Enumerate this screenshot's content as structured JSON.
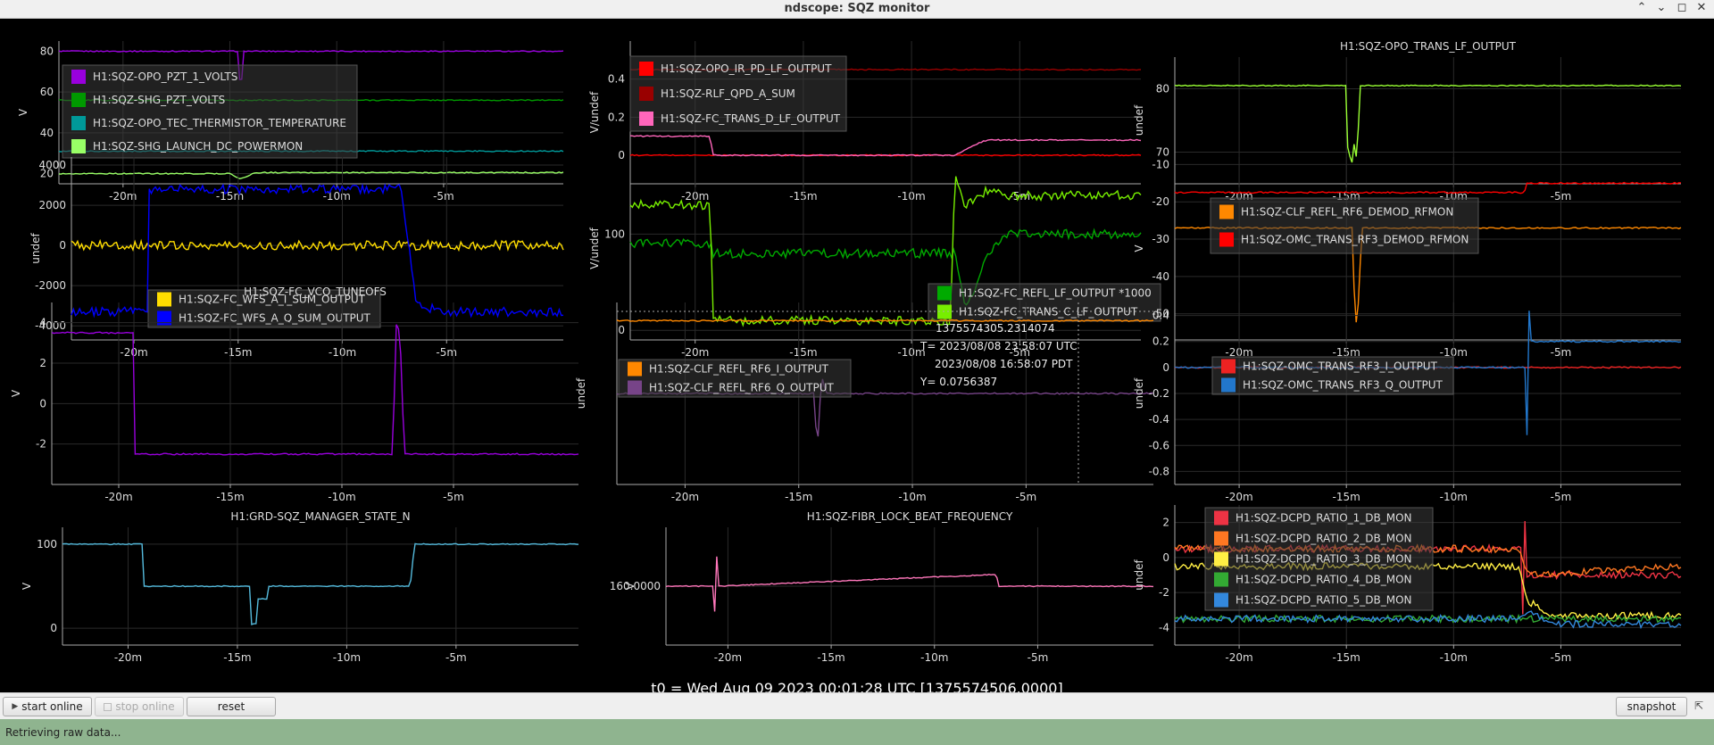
{
  "window": {
    "title": "ndscope: SQZ monitor"
  },
  "t0_label": "t0 = Wed Aug 09 2023 00:01:28 UTC [1375574506.0000]",
  "toolbar": {
    "start_online": "start online",
    "stop_online": "stop online",
    "reset": "reset",
    "snapshot": "snapshot"
  },
  "status": "Retrieving raw data...",
  "colors": {
    "background": "#000000",
    "status_bar": "#8fb48f"
  },
  "chart_data": [
    {
      "type": "line",
      "ylabel": "V",
      "ylim": [
        15,
        85
      ],
      "yticks": [
        20,
        40,
        60,
        80
      ],
      "xlim": [
        -23,
        0.6
      ],
      "xticks": [
        -20,
        -15,
        -10,
        -5
      ],
      "xticklabels": [
        "-20m",
        "-15m",
        "-10m",
        "-5m"
      ],
      "grid": true,
      "legend": "top-left",
      "series": [
        {
          "name": "H1:SQZ-OPO_PZT_1_VOLTS",
          "color": "#9900dd",
          "x": [
            -23,
            -14.6,
            -14.6,
            -14.35,
            -14.35,
            0.6
          ],
          "y": [
            80,
            80,
            66,
            66,
            80,
            80
          ]
        },
        {
          "name": "H1:SQZ-SHG_PZT_VOLTS",
          "color": "#009900",
          "x": [
            -23,
            0.6
          ],
          "y": [
            56,
            56
          ]
        },
        {
          "name": "H1:SQZ-OPO_TEC_THERMISTOR_TEMPERATURE",
          "color": "#009999",
          "x": [
            -23,
            0.6
          ],
          "y": [
            31,
            31
          ]
        },
        {
          "name": "H1:SQZ-SHG_LAUNCH_DC_POWERMON",
          "color": "#99ff66",
          "x": [
            -23,
            -15,
            -14.5,
            -14.2,
            -13.8,
            0.6
          ],
          "y": [
            20,
            20,
            17.5,
            18.5,
            20.5,
            20.5
          ]
        }
      ]
    },
    {
      "type": "line",
      "ylabel": "V/undef",
      "ylim": [
        -0.15,
        0.6
      ],
      "yticks": [
        0,
        0.2,
        0.4
      ],
      "xlim": [
        -23,
        0.6
      ],
      "xticks": [
        -20,
        -15,
        -10,
        -5
      ],
      "xticklabels": [
        "-20m",
        "-15m",
        "-10m",
        "-5m"
      ],
      "grid": true,
      "legend": "top-left",
      "series": [
        {
          "name": "H1:SQZ-OPO_IR_PD_LF_OUTPUT",
          "color": "#ff0000",
          "x": [
            -23,
            0.6
          ],
          "y": [
            0,
            0
          ]
        },
        {
          "name": "H1:SQZ-RLF_QPD_A_SUM",
          "color": "#990000",
          "x": [
            -23,
            0.6
          ],
          "y": [
            0.45,
            0.45
          ]
        },
        {
          "name": "H1:SQZ-FC_TRANS_D_LF_OUTPUT",
          "color": "#ff66bb",
          "x": [
            -23,
            -19.3,
            -19.2,
            -8,
            -7.5,
            -7,
            -6.5,
            0.6
          ],
          "y": [
            0.1,
            0.1,
            0,
            0,
            0.03,
            0.06,
            0.08,
            0.08
          ]
        }
      ]
    },
    {
      "type": "line",
      "title": "H1:SQZ-OPO_TRANS_LF_OUTPUT",
      "ylabel": "undef",
      "ylim": [
        65,
        85
      ],
      "yticks": [
        70,
        80
      ],
      "xlim": [
        -23,
        0.6
      ],
      "xticks": [
        -20,
        -15,
        -10,
        -5
      ],
      "xticklabels": [
        "-20m",
        "-15m",
        "-10m",
        "-5m"
      ],
      "grid": true,
      "series": [
        {
          "name": "",
          "color": "#99ff33",
          "x": [
            -23,
            -15,
            -14.9,
            -14.8,
            -14.7,
            -14.6,
            -14.5,
            -14.4,
            0.6
          ],
          "y": [
            80.5,
            80.5,
            65,
            72,
            66,
            75,
            65,
            80.5,
            80.5
          ]
        }
      ]
    },
    {
      "type": "line",
      "ylabel": "undef",
      "ylim": [
        -4700,
        4400
      ],
      "yticks": [
        -4000,
        -2000,
        0,
        2000,
        4000
      ],
      "xlim": [
        -23,
        0.6
      ],
      "xticks": [
        -20,
        -15,
        -10,
        -5
      ],
      "xticklabels": [
        "-20m",
        "-15m",
        "-10m",
        "-5m"
      ],
      "grid": true,
      "legend": "bottom-left",
      "series": [
        {
          "name": "H1:SQZ-FC_WFS_A_I_SUM_OUTPUT",
          "color": "#ffdd00",
          "x": [
            -23,
            0.6
          ],
          "y": [
            0,
            0
          ]
        },
        {
          "name": "H1:SQZ-FC_WFS_A_Q_SUM_OUTPUT",
          "color": "#0000ff",
          "x": [
            -23,
            -19.3,
            -19.3,
            -7.2,
            -6.5,
            -6,
            -5,
            0.6
          ],
          "y": [
            -3300,
            -3300,
            2800,
            2800,
            -2500,
            -3100,
            -3300,
            -3300
          ]
        }
      ]
    },
    {
      "type": "line",
      "ylabel": "V/undef",
      "ylim": [
        -10,
        180
      ],
      "yticks": [
        0,
        100
      ],
      "xlim": [
        -23,
        0.6
      ],
      "xticks": [
        -20,
        -15,
        -10,
        -5
      ],
      "xticklabels": [
        "-20m",
        "-15m",
        "-10m",
        "-5m"
      ],
      "grid": true,
      "legend": "bottom-right",
      "series": [
        {
          "name": "H1:SQZ-FC_REFL_LF_OUTPUT *1000",
          "color": "#00aa00",
          "x": [
            -23,
            -19.3,
            -19.2,
            -8,
            -7.5,
            -6.5,
            -5.5,
            0.6
          ],
          "y": [
            90,
            90,
            80,
            80,
            20,
            80,
            100,
            100
          ]
        },
        {
          "name": "H1:SQZ-FC_TRANS_C_LF_OUTPUT",
          "color": "#77ee00",
          "x": [
            -23,
            -19.3,
            -19.2,
            -8.2,
            -8,
            -7.5,
            -6.5,
            -5.5,
            0.6
          ],
          "y": [
            130,
            130,
            10,
            10,
            160,
            130,
            145,
            140,
            140
          ]
        }
      ]
    },
    {
      "type": "line",
      "ylabel": "V",
      "ylim": [
        -57,
        -8
      ],
      "yticks": [
        -50,
        -40,
        -30,
        -20,
        -10
      ],
      "xlim": [
        -23,
        0.6
      ],
      "xticks": [
        -20,
        -15,
        -10,
        -5
      ],
      "xticklabels": [
        "-20m",
        "-15m",
        "-10m",
        "-5m"
      ],
      "grid": true,
      "legend": "top-left",
      "series": [
        {
          "name": "H1:SQZ-CLF_REFL_RF6_DEMOD_RFMON",
          "color": "#ff8800",
          "x": [
            -23,
            -14.7,
            -14.6,
            -14.4,
            -14.3,
            0.6
          ],
          "y": [
            -27,
            -27,
            -55,
            -45,
            -27,
            -27
          ]
        },
        {
          "name": "H1:SQZ-OMC_TRANS_RF3_DEMOD_RFMON",
          "color": "#ff0000",
          "x": [
            -23,
            -6.7,
            -6.6,
            0.6
          ],
          "y": [
            -17.5,
            -17.5,
            -15,
            -15
          ]
        }
      ]
    },
    {
      "type": "line",
      "title": "H1:SQZ-FC_VCO_TUNEOFS",
      "ylabel": "V",
      "ylim": [
        -4,
        5
      ],
      "yticks": [
        -2,
        0,
        2,
        4
      ],
      "xlim": [
        -23,
        0.6
      ],
      "xticks": [
        -20,
        -15,
        -10,
        -5
      ],
      "xticklabels": [
        "-20m",
        "-15m",
        "-10m",
        "-5m"
      ],
      "grid": true,
      "series": [
        {
          "name": "",
          "color": "#9900dd",
          "x": [
            -23,
            -19.3,
            -19.3,
            -7.7,
            -7.6,
            -7.4,
            -7.2,
            0.6
          ],
          "y": [
            3.5,
            3.5,
            -2.5,
            -2.5,
            4,
            3.5,
            -2.5,
            -2.5
          ]
        }
      ]
    },
    {
      "type": "line",
      "ylabel": "undef",
      "ylim": [
        -0.5,
        0.5
      ],
      "yticks": [],
      "xlim": [
        -23,
        0.6
      ],
      "xticks": [
        -20,
        -15,
        -10,
        -5
      ],
      "xticklabels": [
        "-20m",
        "-15m",
        "-10m",
        "-5m"
      ],
      "grid": true,
      "legend": "top-left",
      "series": [
        {
          "name": "H1:SQZ-CLF_REFL_RF6_I_OUTPUT",
          "color": "#ff8800",
          "x": [
            -23,
            0.6
          ],
          "y": [
            0.4,
            0.4
          ]
        },
        {
          "name": "H1:SQZ-CLF_REFL_RF6_Q_OUTPUT",
          "color": "#774488",
          "x": [
            -23,
            -14.3,
            -14.2,
            -14,
            -13.8,
            0.6
          ],
          "y": [
            0,
            0,
            -0.35,
            0.1,
            0,
            0
          ]
        }
      ]
    },
    {
      "type": "line",
      "ylabel": "undef",
      "ylim": [
        -0.9,
        0.5
      ],
      "yticks": [
        -0.8,
        -0.6,
        -0.4,
        -0.2,
        0,
        0.2,
        0.4
      ],
      "xlim": [
        -23,
        0.6
      ],
      "xticks": [
        -20,
        -15,
        -10,
        -5
      ],
      "xticklabels": [
        "-20m",
        "-15m",
        "-10m",
        "-5m"
      ],
      "grid": true,
      "legend": "top-left",
      "series": [
        {
          "name": "H1:SQZ-OMC_TRANS_RF3_I_OUTPUT",
          "color": "#ee2222",
          "x": [
            -23,
            0.6
          ],
          "y": [
            0,
            0
          ]
        },
        {
          "name": "H1:SQZ-OMC_TRANS_RF3_Q_OUTPUT",
          "color": "#2277cc",
          "x": [
            -23,
            -6.6,
            -6.6,
            -6.5,
            -6.4,
            0.6
          ],
          "y": [
            0,
            0,
            -0.8,
            0.5,
            0.2,
            0.2
          ]
        }
      ]
    },
    {
      "type": "line",
      "title": "H1:GRD-SQZ_MANAGER_STATE_N",
      "ylabel": "V",
      "ylim": [
        -20,
        120
      ],
      "yticks": [
        0,
        100
      ],
      "xlim": [
        -23,
        0.6
      ],
      "xticks": [
        -20,
        -15,
        -10,
        -5
      ],
      "xticklabels": [
        "-20m",
        "-15m",
        "-10m",
        "-5m"
      ],
      "grid": true,
      "series": [
        {
          "name": "",
          "color": "#55bbdd",
          "x": [
            -23,
            -19.3,
            -19.3,
            -14.4,
            -14.4,
            -14.1,
            -14.1,
            -13.6,
            -13.6,
            -7.1,
            -6.9,
            0.6
          ],
          "y": [
            100,
            100,
            50,
            50,
            5,
            5,
            35,
            35,
            50,
            50,
            100,
            100
          ]
        }
      ]
    },
    {
      "type": "line",
      "title": "H1:SQZ-FIBR_LOCK_BEAT_FREQUENCY",
      "ylabel": "V",
      "ylim": [
        159,
        161
      ],
      "yticks": [
        160
      ],
      "yticklabels": [
        "160.0000"
      ],
      "xlim": [
        -23,
        0.6
      ],
      "xticks": [
        -20,
        -15,
        -10,
        -5
      ],
      "xticklabels": [
        "-20m",
        "-15m",
        "-10m",
        "-5m"
      ],
      "grid": true,
      "series": [
        {
          "name": "",
          "color": "#ff77bb",
          "x": [
            -23,
            -20.7,
            -20.7,
            -20.5,
            -20.5,
            -7,
            -6.9,
            0.6
          ],
          "y": [
            160,
            160,
            159,
            160.9,
            160,
            160.2,
            160,
            160
          ]
        }
      ]
    },
    {
      "type": "line",
      "ylabel": "undef",
      "ylim": [
        -5,
        3
      ],
      "yticks": [
        -4,
        -2,
        0,
        2
      ],
      "xlim": [
        -23,
        0.6
      ],
      "xticks": [
        -20,
        -15,
        -10,
        -5
      ],
      "xticklabels": [
        "-20m",
        "-15m",
        "-10m",
        "-5m"
      ],
      "grid": true,
      "legend": "bottom-left",
      "series": [
        {
          "name": "H1:SQZ-DCPD_RATIO_1_DB_MON",
          "color": "#ee3344",
          "x": [
            -23,
            -6.8,
            -6.8,
            -6.7,
            -6.6,
            0.6
          ],
          "y": [
            0.5,
            0.5,
            -5,
            2.8,
            -1,
            -1
          ]
        },
        {
          "name": "H1:SQZ-DCPD_RATIO_2_DB_MON",
          "color": "#ff7722",
          "x": [
            -23,
            -7,
            -6.5,
            0.6
          ],
          "y": [
            0.5,
            0.5,
            -1,
            -0.5
          ]
        },
        {
          "name": "H1:SQZ-DCPD_RATIO_3_DB_MON",
          "color": "#ffee44",
          "x": [
            -23,
            -7,
            -6.5,
            -5.5,
            0.6
          ],
          "y": [
            -0.5,
            -0.5,
            -2.5,
            -3.3,
            -3.3
          ]
        },
        {
          "name": "H1:SQZ-DCPD_RATIO_4_DB_MON",
          "color": "#33aa33",
          "x": [
            -23,
            0.6
          ],
          "y": [
            -3.5,
            -3.5
          ]
        },
        {
          "name": "H1:SQZ-DCPD_RATIO_5_DB_MON",
          "color": "#3388dd",
          "x": [
            -23,
            -7,
            -6.5,
            -5.5,
            0.6
          ],
          "y": [
            -3.5,
            -3.5,
            -3,
            -3.8,
            -3.8
          ]
        }
      ]
    }
  ],
  "crosshair": {
    "time_label": "1375574305.2314074",
    "utc_label": "T= 2023/08/08 23:58:07 UTC",
    "pdt_label": "2023/08/08 16:58:07 PDT",
    "y_label": "Y= 0.0756387"
  }
}
